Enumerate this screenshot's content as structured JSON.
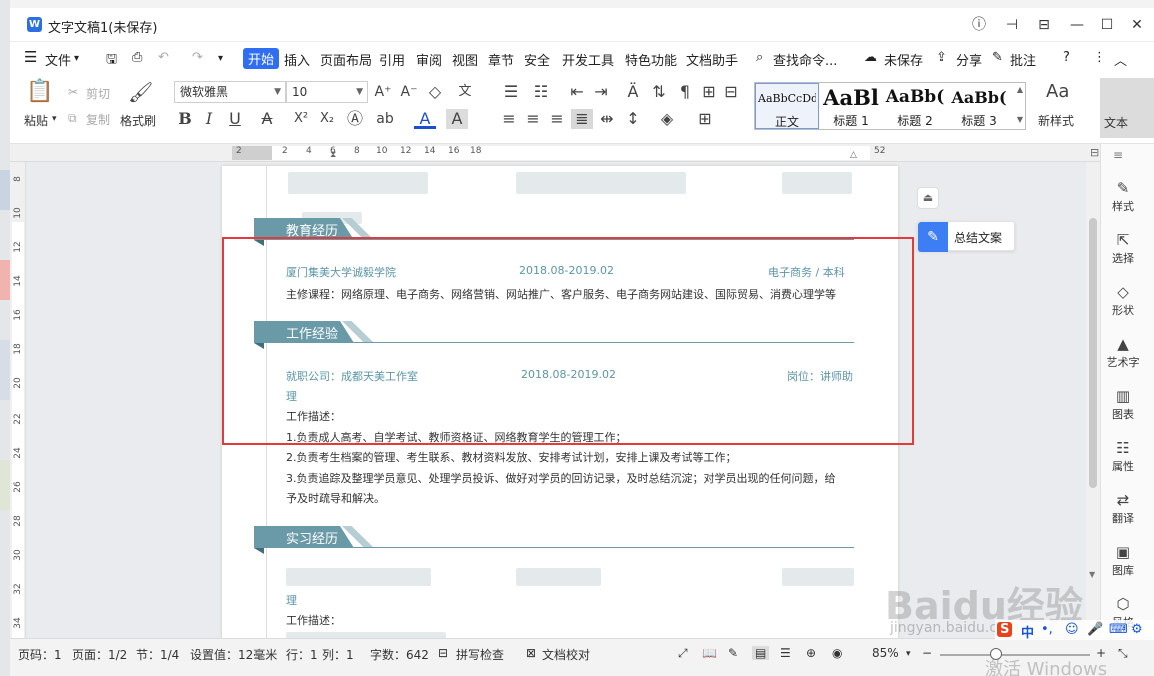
{
  "window": {
    "title": "文字文稿1(未保存)",
    "logo": "W"
  },
  "menu": {
    "file": "文件",
    "tabs": [
      "开始",
      "插入",
      "页面布局",
      "引用",
      "审阅",
      "视图",
      "章节",
      "安全",
      "开发工具",
      "特色功能",
      "文档助手"
    ],
    "search": "查找命令...",
    "unsaved": "未保存",
    "share": "分享",
    "comment": "批注"
  },
  "toolbar": {
    "paste": "粘贴",
    "cut": "剪切",
    "copy": "复制",
    "format_painter": "格式刷",
    "font": "微软雅黑",
    "size": "10",
    "styles": [
      {
        "sample": "AaBbCcDd",
        "label": "正文"
      },
      {
        "sample": "AaBl",
        "label": "标题 1"
      },
      {
        "sample": "AaBb(",
        "label": "标题 2"
      },
      {
        "sample": "AaBb(",
        "label": "标题 3"
      }
    ],
    "new_style": "新样式",
    "text_tools": "文本"
  },
  "ruler": {
    "h_ticks": [
      "2",
      "2",
      "4",
      "6",
      "8",
      "10",
      "12",
      "14",
      "16",
      "18",
      "52"
    ],
    "v_ticks": [
      "8",
      "10",
      "12",
      "14",
      "16",
      "18",
      "20",
      "22",
      "24",
      "26",
      "28",
      "30",
      "32",
      "34"
    ]
  },
  "document": {
    "edu_heading": "教育经历",
    "school": "厦门集美大学诚毅学院",
    "edu_date": "2018.08-2019.02",
    "edu_degree": "电子商务 / 本科",
    "courses": "主修课程：网络原理、电子商务、网络营销、网站推广、客户服务、电子商务网站建设、国际贸易、消费心理学等",
    "work_heading": "工作经验",
    "company": "就职公司：成都天美工作室",
    "work_date": "2018.08-2019.02",
    "position": "岗位：讲师助",
    "position_cont": "理",
    "desc_title": "工作描述：",
    "desc_1": "1.负责成人高考、自学考试、教师资格证、网络教育学生的管理工作；",
    "desc_2": "2.负责考生档案的管理、考生联系、教材资料发放、安排考试计划，安排上课及考试等工作；",
    "desc_3a": "3.负责追踪及整理学员意见、处理学员投诉、做好对学员的回访记录，及时总结沉淀；对学员出现的任何问题，给",
    "desc_3b": "予及时疏导和解决。",
    "intern_heading": "实习经历",
    "intern_cont": "理",
    "intern_desc_title": "工作描述："
  },
  "side_panel": {
    "summary": "总结文案"
  },
  "right_panel": [
    "样式",
    "选择",
    "形状",
    "艺术字",
    "图表",
    "属性",
    "翻译",
    "图库",
    "风格"
  ],
  "status": {
    "page_code": "页码：1",
    "pages": "页面：1/2",
    "section": "节：1/4",
    "setting": "设置值：12毫米",
    "row": "行：1",
    "col": "列：1",
    "words": "字数：642",
    "spell": "拼写检查",
    "proof": "文档校对",
    "zoom": "85%"
  },
  "overlay": {
    "watermark": "Baidu经验",
    "watermark_url": "jingyan.baidu.com",
    "tray_lang": "中",
    "activate": "激活 Windows"
  },
  "colors": {
    "accent": "#2f6ef2",
    "section_band": "#6a9aa7",
    "teal_text": "#5b96a7",
    "highlight": "#e23b3b"
  }
}
